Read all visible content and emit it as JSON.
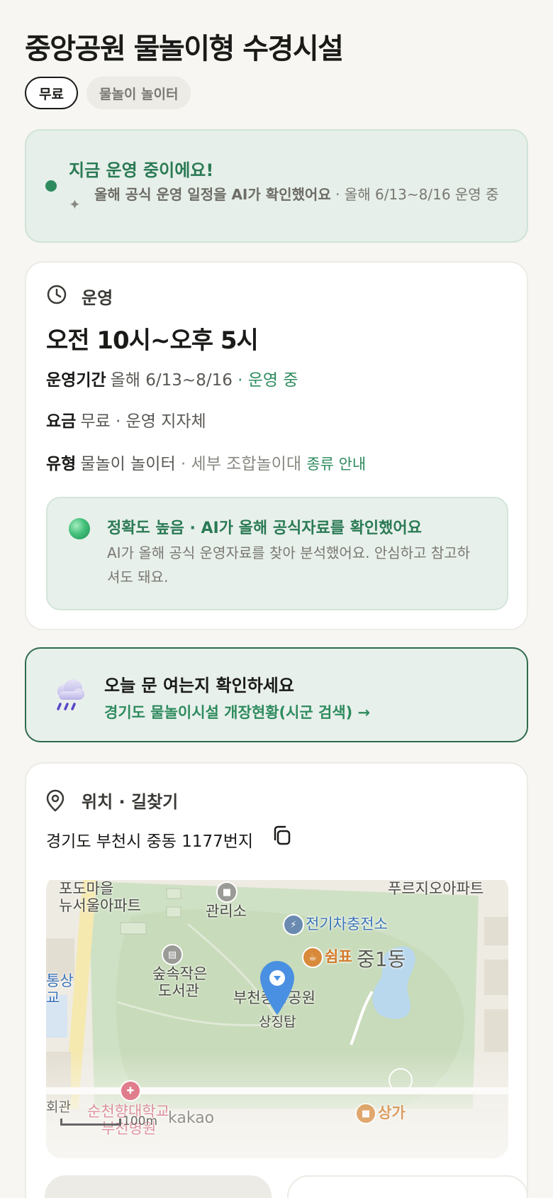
{
  "header": {
    "title": "중앙공원 물놀이형 수경시설",
    "chips": [
      "무료",
      "물놀이 놀이터"
    ]
  },
  "status": {
    "headline": "지금 운영 중이에요!",
    "sub_bold": "올해 공식 운영 일정을 AI가 확인했어요",
    "sub_rest": " · 올해 6/13~8/16 운영 중"
  },
  "operation": {
    "section_label": "운영",
    "hours": "오전 10시~오후 5시",
    "period_label": "운영기간",
    "period_value": "올해 6/13~8/16",
    "period_status": " · 운영 중",
    "fee_label": "요금",
    "fee_value": "무료 · 운영 지자체",
    "type_label": "유형",
    "type_value": "물놀이 놀이터",
    "type_detail": " · 세부 조합놀이대",
    "type_link": "종류 안내",
    "accuracy_title": "정확도 높음 · AI가 올해 공식자료를 확인했어요",
    "accuracy_body": "AI가 올해 공식 운영자료를 찾아 분석했어요. 안심하고 참고하셔도 돼요."
  },
  "notice": {
    "headline": "오늘 문 여는지 확인하세요",
    "link": "경기도 물놀이시설 개장현황(시군 검색) →"
  },
  "location": {
    "section_label": "위치 · 길찾기",
    "address": "경기도 부천시 중동 1177번지",
    "map_labels": {
      "podomaeul": "포도마을",
      "newseoul": "뉴서울아파트",
      "office": "관리소",
      "apartment_top": "푸르지오아파트",
      "ev": "전기차충전소",
      "rest": "쉼표",
      "dong": "중1동",
      "library_1": "숲속작은",
      "library_2": "도서관",
      "park": "부천중앙공원",
      "tower": "상징탑",
      "left_1": "통상",
      "left_2": "교",
      "hospital": "순천향대학교",
      "hospital_2": "부천병원",
      "hall": "회관",
      "store": "상가",
      "scale": "100m",
      "brand": "kakao"
    }
  },
  "colors": {
    "accent_green": "#2e8b5e",
    "status_bg": "#e6efe9",
    "notice_border": "#2f6b4c",
    "pin_blue": "#4a90e2"
  },
  "icons": {
    "status": "green-dot-icon",
    "sparkle": "sparkle-icon",
    "clock": "clock-icon",
    "orb": "accuracy-orb-icon",
    "rain": "rain-cloud-icon",
    "location": "location-pin-icon",
    "copy": "copy-icon",
    "map_pin": "map-marker-icon"
  }
}
